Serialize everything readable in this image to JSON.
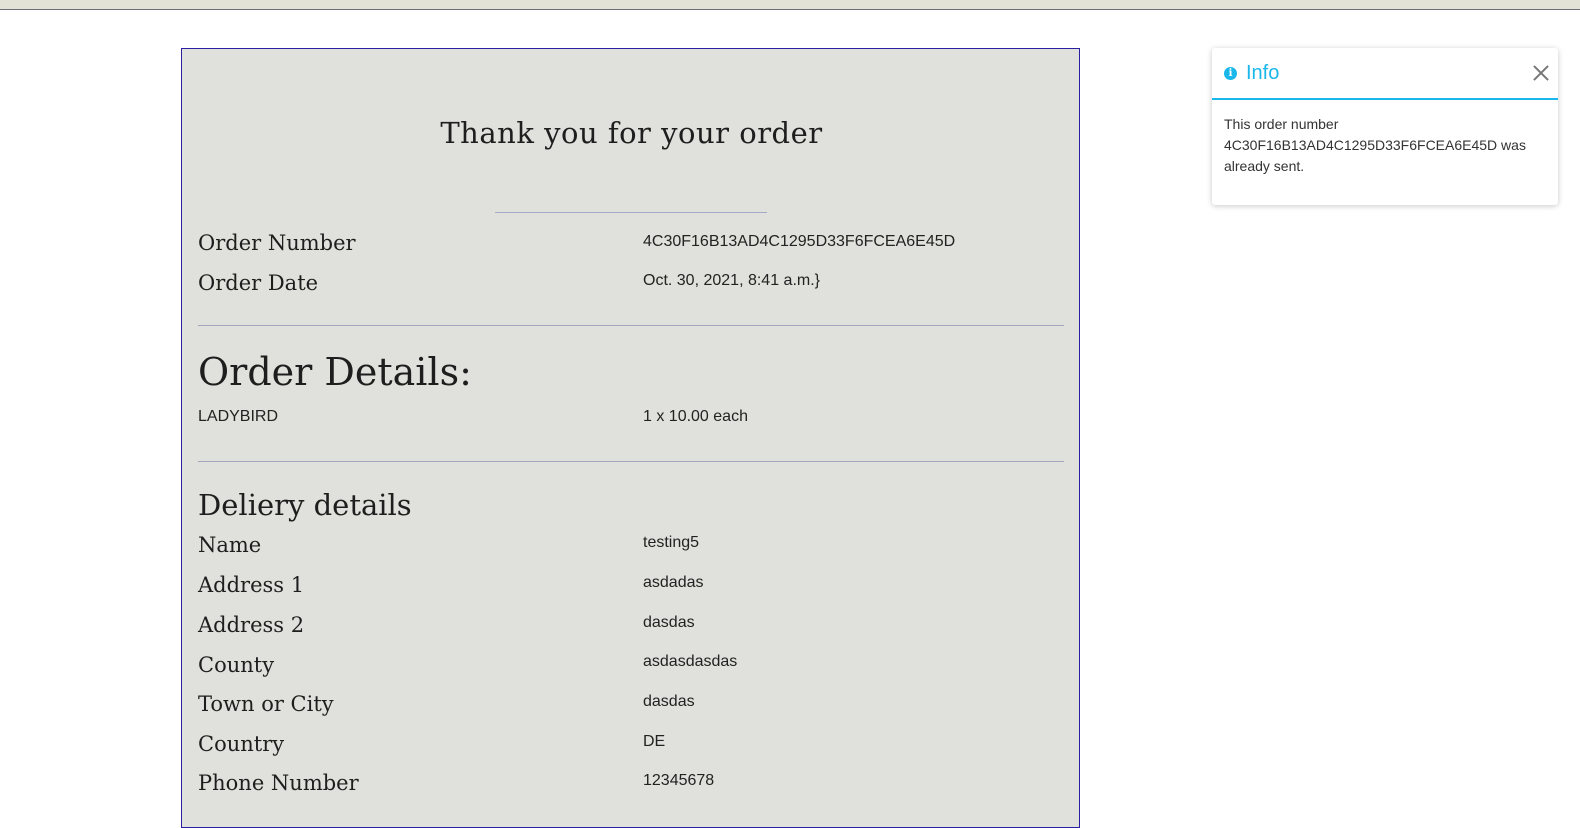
{
  "order": {
    "title": "Thank you for your order",
    "fields": [
      {
        "label": "Order Number",
        "value": "4C30F16B13AD4C1295D33F6FCEA6E45D"
      },
      {
        "label": "Order Date",
        "value": "Oct. 30, 2021, 8:41 a.m.}"
      }
    ],
    "details_heading": "Order Details:",
    "item": {
      "name": "LADYBIRD",
      "quantity": "1 x 10.00 each"
    },
    "delivery_heading": "Deliery details",
    "delivery": [
      {
        "label": "Name",
        "value": "testing5"
      },
      {
        "label": "Address 1",
        "value": "asdadas"
      },
      {
        "label": "Address 2",
        "value": "dasdas"
      },
      {
        "label": "County",
        "value": "asdasdasdas"
      },
      {
        "label": "Town or City",
        "value": "dasdas"
      },
      {
        "label": "Country",
        "value": "DE"
      },
      {
        "label": "Phone Number",
        "value": "12345678"
      }
    ]
  },
  "toast": {
    "icon": "info-icon",
    "icon_glyph": "i",
    "title": "Info",
    "message": "This order number 4C30F16B13AD4C1295D33F6FCEA6E45D was already sent.",
    "accent_color": "#19b7ea"
  }
}
